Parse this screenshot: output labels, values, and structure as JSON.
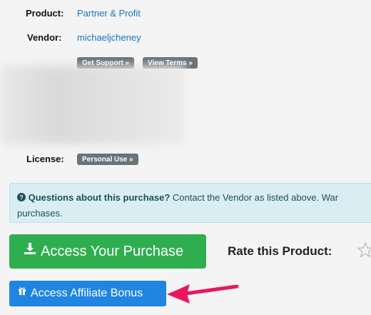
{
  "details": {
    "product_label": "Product:",
    "product_value": "Partner & Profit",
    "vendor_label": "Vendor:",
    "vendor_value": "michaeljcheney",
    "get_support": "Get Support »",
    "view_terms": "View Terms »",
    "license_label": "License:",
    "license_value": "Personal Use »"
  },
  "alert": {
    "question": "Questions about this purchase?",
    "message": " Contact the Vendor as listed above. War",
    "message_line2": "purchases."
  },
  "actions": {
    "access_purchase": "Access Your Purchase",
    "access_bonus": "Access Affiliate Bonus",
    "rate_label": "Rate this Product:"
  },
  "icons": {
    "download": "download-icon",
    "gift": "gift-icon",
    "question": "question-circle-icon",
    "star": "star-icon",
    "arrow": "arrow-annotation-icon"
  },
  "colors": {
    "link": "#1a73c8",
    "green_button": "#2fae4f",
    "blue_button": "#1f85e0",
    "arrow": "#e8175d",
    "alert_bg": "#d9eef3"
  }
}
